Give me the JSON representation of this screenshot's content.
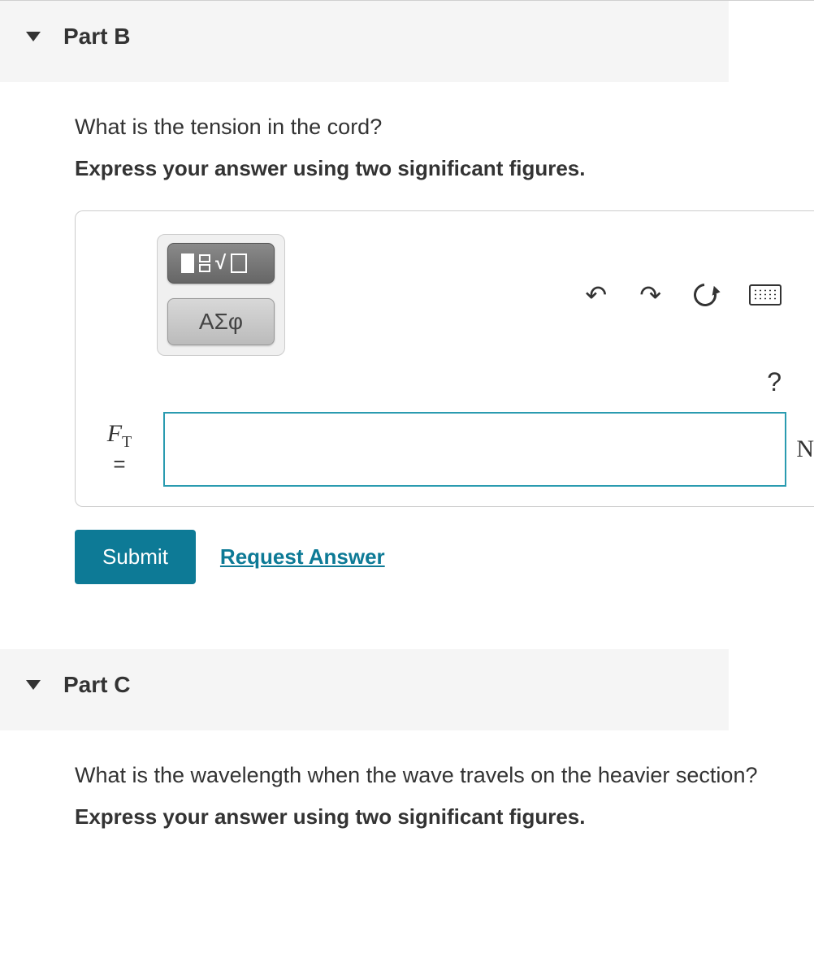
{
  "partB": {
    "title": "Part B",
    "question": "What is the tension in the cord?",
    "instruction": "Express your answer using two significant figures.",
    "greek_label": "ΑΣφ",
    "help_label": "?",
    "variable_html": "F",
    "variable_sub": "T",
    "equals": "=",
    "unit": "N",
    "submit": "Submit",
    "request": "Request Answer"
  },
  "partC": {
    "title": "Part C",
    "question": "What is the wavelength when the wave travels on the heavier section?",
    "instruction": "Express your answer using two significant figures."
  },
  "icons": {
    "undo": "↶",
    "redo": "↷"
  }
}
